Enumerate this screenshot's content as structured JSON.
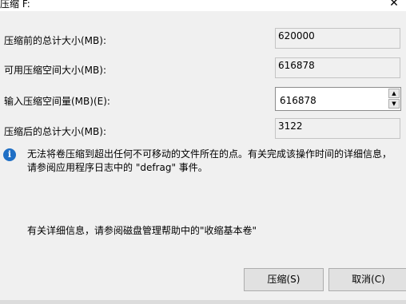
{
  "window": {
    "title": "压缩 F:",
    "close_symbol": "✕"
  },
  "fields": {
    "total_before": {
      "label": "压缩前的总计大小(MB):",
      "value": "620000"
    },
    "available": {
      "label": "可用压缩空间大小(MB):",
      "value": "616878"
    },
    "shrink_amount": {
      "label": "输入压缩空间量(MB)(E):",
      "value": "616878",
      "up": "▲",
      "down": "▼"
    },
    "total_after": {
      "label": "压缩后的总计大小(MB):",
      "value": "3122"
    }
  },
  "info": {
    "icon": "i",
    "message": "无法将卷压缩到超出任何不可移动的文件所在的点。有关完成该操作时间的详细信息，请参阅应用程序日志中的 \"defrag\" 事件。"
  },
  "help_text": "有关详细信息，请参阅磁盘管理帮助中的\"收缩基本卷\"",
  "buttons": {
    "shrink": "压缩(S)",
    "cancel": "取消(C)"
  }
}
